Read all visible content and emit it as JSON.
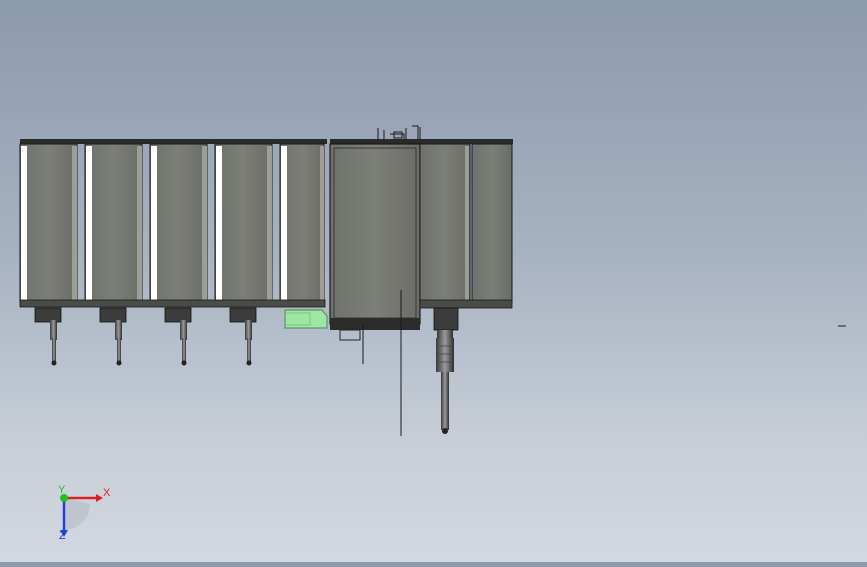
{
  "view": {
    "background_top": "#8c9aad",
    "background_bottom": "#d2d8df",
    "body_color": "#777a72",
    "edge_color": "#1a1a1a",
    "highlight_color": "#ffffff",
    "selected_part_color": "#9ee6a6"
  },
  "triad": {
    "x_label": "X",
    "y_label": "Y",
    "z_label": "Z",
    "x_color": "#e02020",
    "y_color": "#20c020",
    "z_color": "#2040e0"
  },
  "model": {
    "module_count": 5,
    "probe_count": 4
  }
}
